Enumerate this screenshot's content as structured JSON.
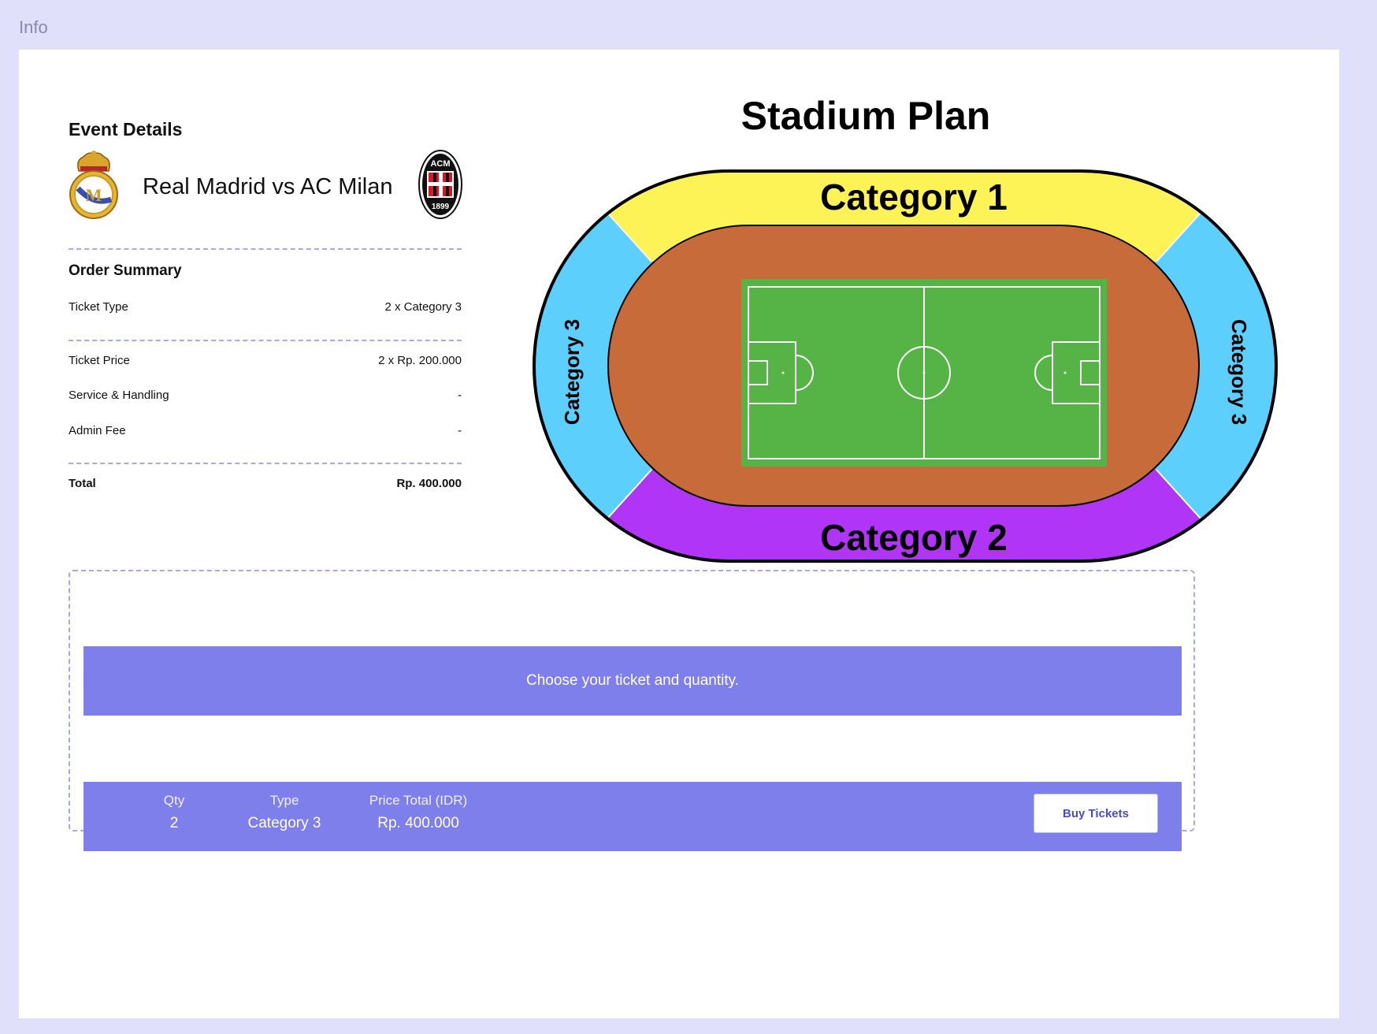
{
  "frame": {
    "label": "Info"
  },
  "event": {
    "section_title": "Event Details",
    "match": "Real Madrid vs AC Milan",
    "home_logo_text": "",
    "away_logo_text": "ACM 1899"
  },
  "order": {
    "section_title": "Order Summary",
    "ticket_type_label": "Ticket Type",
    "ticket_type_value": "2 x Category 3",
    "ticket_price_label": "Ticket Price",
    "ticket_price_value": "2 x Rp. 200.000",
    "service_label": "Service & Handling",
    "service_value": "-",
    "admin_label": "Admin Fee",
    "admin_value": "-",
    "total_label": "Total",
    "total_value": "Rp. 400.000"
  },
  "stadium": {
    "title": "Stadium Plan",
    "category1": "Category 1",
    "category2": "Category 2",
    "category3_left": "Category 3",
    "category3_right": "Category 3",
    "colors": {
      "category1": "#fdf356",
      "category2": "#b035f7",
      "category3": "#5dcffc",
      "track": "#c66b39",
      "pitch": "#56b346"
    }
  },
  "tickets": {
    "banner_text": "Choose your ticket and quantity.",
    "qty_label": "Qty",
    "qty_value": "2",
    "type_label": "Type",
    "type_value": "Category 3",
    "price_label": "Price Total (IDR)",
    "price_value": "Rp. 400.000",
    "buy_button": "Buy Tickets"
  }
}
